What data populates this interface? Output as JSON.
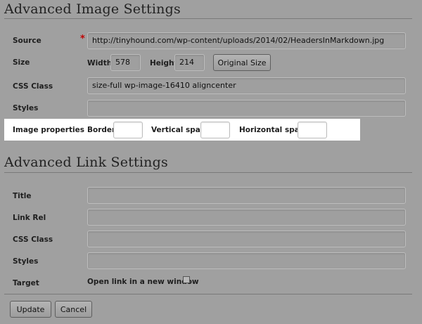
{
  "image_settings": {
    "title": "Advanced Image Settings",
    "source_label": "Source",
    "source_required_marker": "*",
    "source_value": "http://tinyhound.com/wp-content/uploads/2014/02/HeadersInMarkdown.jpg",
    "size_label": "Size",
    "width_label": "Width",
    "width_value": "578",
    "height_label": "Height",
    "height_value": "214",
    "original_size_button": "Original Size",
    "css_class_label": "CSS Class",
    "css_class_value": "size-full wp-image-16410 aligncenter",
    "styles_label": "Styles",
    "styles_value": "",
    "image_properties_label": "Image properties",
    "border_label": "Border",
    "border_value": "",
    "vertical_space_label": "Vertical space",
    "vertical_space_value": "",
    "horizontal_space_label": "Horizontal space",
    "horizontal_space_value": ""
  },
  "link_settings": {
    "title": "Advanced Link Settings",
    "title_label": "Title",
    "title_value": "",
    "link_rel_label": "Link Rel",
    "link_rel_value": "",
    "css_class_label": "CSS Class",
    "css_class_value": "",
    "styles_label": "Styles",
    "styles_value": "",
    "target_label": "Target",
    "new_window_label": "Open link in a new window",
    "new_window_checked": false
  },
  "footer": {
    "update_button": "Update",
    "cancel_button": "Cancel"
  }
}
